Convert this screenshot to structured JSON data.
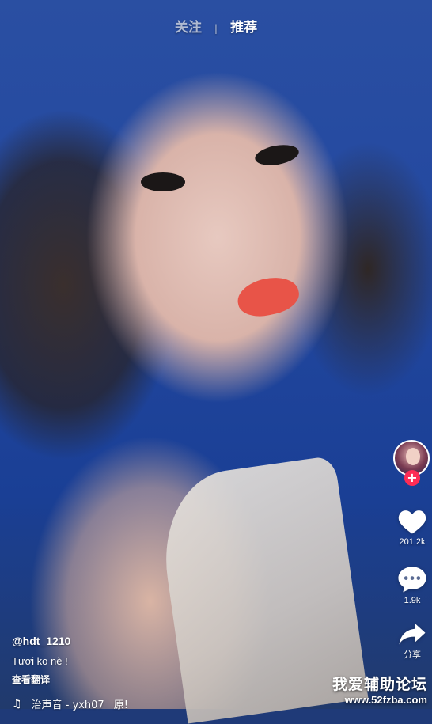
{
  "top_nav": {
    "following": "关注",
    "separator": "|",
    "for_you": "推荐"
  },
  "right_rail": {
    "likes": "201.2k",
    "comments": "1.9k",
    "share": "分享"
  },
  "post": {
    "username": "@hdt_1210",
    "description": "Tươi ko nè !",
    "translate": "查看翻译",
    "music": "治声音 - yxh07",
    "music_suffix": "原!"
  },
  "watermark": {
    "title": "我爱辅助论坛",
    "url": "www.52fzba.com"
  },
  "colors": {
    "accent": "#fe2c55"
  }
}
